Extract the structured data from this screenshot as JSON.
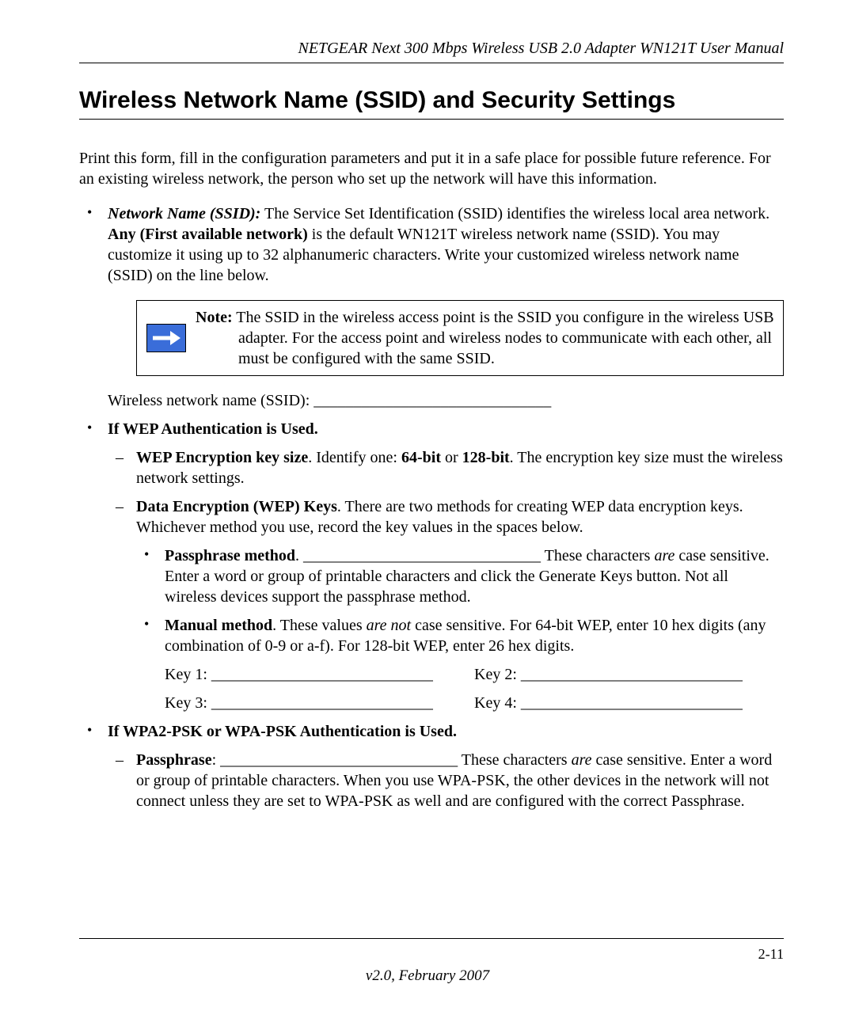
{
  "header": {
    "running_title": "NETGEAR Next 300 Mbps Wireless USB 2.0 Adapter WN121T User Manual"
  },
  "section_title": "Wireless Network Name (SSID) and Security Settings",
  "intro_paragraph": "Print this form, fill in the configuration parameters and put it in a safe place for possible future reference. For an existing wireless network, the person who set up the network will have this information.",
  "ssid_bullet": {
    "label": "Network Name (SSID):",
    "text_part1": " The Service Set Identification (SSID) identifies the wireless local area network. ",
    "bold_any": "Any (First available network)",
    "text_part2": " is the default WN121T wireless network name (SSID). You may customize it using up to 32 alphanumeric characters. Write your customized wireless network name (SSID) on the line below."
  },
  "note": {
    "prefix": "Note:",
    "body_line": " The SSID in the wireless access point is the SSID you configure in the wireless USB adapter. For the access point and wireless nodes to communicate with each other, all must be configured with the same SSID."
  },
  "ssid_form_line": "Wireless network name (SSID): ______________________________",
  "wep_heading": "If WEP Authentication is Used.",
  "wep_keysize": {
    "label": "WEP Encryption key size",
    "mid": ". Identify one: ",
    "opt64": "64-bit",
    "or": " or ",
    "opt128": "128-bit",
    "tail": ". The encryption key size must the wireless network settings."
  },
  "wep_datakeys": {
    "label": "Data Encryption (WEP) Keys",
    "tail": ". There are two methods for creating WEP data encryption keys. Whichever method you use, record the key values in the spaces below."
  },
  "passphrase_method": {
    "label": "Passphrase method",
    "blank": ". ______________________________ These characters ",
    "are": "are",
    "tail": " case sensitive. Enter a word or group of printable characters and click the Generate Keys button. Not all wireless devices support the passphrase method."
  },
  "manual_method": {
    "label": "Manual method",
    "lead": ". These values ",
    "arenot": "are not",
    "tail": " case sensitive. For 64-bit WEP, enter 10 hex digits (any combination of 0-9 or a-f). For 128-bit WEP, enter 26 hex digits."
  },
  "keys": {
    "k1": "Key 1: ____________________________",
    "k2": "Key 2: ____________________________",
    "k3": "Key 3: ____________________________",
    "k4": "Key 4: ____________________________"
  },
  "wpa_heading": "If WPA2-PSK or WPA-PSK Authentication is Used.",
  "wpa_passphrase": {
    "label": "Passphrase",
    "blank": ": ______________________________ These characters ",
    "are": "are",
    "tail": " case sensitive. Enter a word or group of printable characters. When you use WPA-PSK, the other devices in the network will not connect unless they are set to WPA-PSK as well and are configured with the correct Passphrase."
  },
  "footer": {
    "page_number": "2-11",
    "version": "v2.0, February 2007"
  }
}
